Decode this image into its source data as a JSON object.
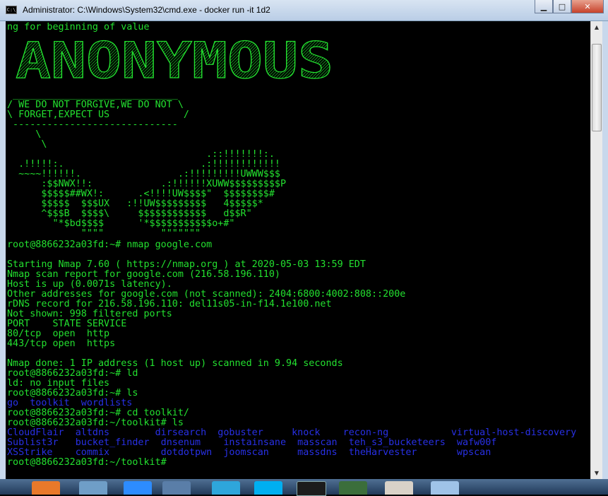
{
  "window": {
    "title": "Administrator: C:\\Windows\\System32\\cmd.exe - docker  run -it 1d2",
    "minimize_icon": "minimize-icon",
    "maximize_icon": "maximize-icon",
    "close_icon": "close-icon"
  },
  "terminal": {
    "top_line": "ng for beginning of value",
    "banner_logo": "ANONYMOUS",
    "banner_box": [
      " _____________________________",
      "/ WE DO NOT FORGIVE,WE DO NOT \\",
      "\\ FORGET,EXPECT US             /",
      " -----------------------------",
      "     \\",
      "      \\"
    ],
    "art": [
      "                                   .::!!!!!!!:.",
      "  .!!!!!:.                        .:!!!!!!!!!!!!",
      "  ~~~~!!!!!!.                 .:!!!!!!!!!UWWW$$$",
      "      :$$NWX!!:            .:!!!!!!XUWW$$$$$$$$$P",
      "      $$$$$##WX!:      .<!!!!UW$$$$\"  $$$$$$$$#",
      "      $$$$$  $$$UX   :!!UW$$$$$$$$$   4$$$$$*",
      "      ^$$$B  $$$$\\     $$$$$$$$$$$$   d$$R\"",
      "        \"*$bd$$$$      '*$$$$$$$$$$$o+#\"",
      "             \"\"\"\"          \"\"\"\"\"\"\""
    ],
    "lines": [
      "root@8866232a03fd:~# nmap google.com",
      "",
      "Starting Nmap 7.60 ( https://nmap.org ) at 2020-05-03 13:59 EDT",
      "Nmap scan report for google.com (216.58.196.110)",
      "Host is up (0.0071s latency).",
      "Other addresses for google.com (not scanned): 2404:6800:4002:808::200e",
      "rDNS record for 216.58.196.110: del11s05-in-f14.1e100.net",
      "Not shown: 998 filtered ports",
      "PORT    STATE SERVICE",
      "80/tcp  open  http",
      "443/tcp open  https",
      "",
      "Nmap done: 1 IP address (1 host up) scanned in 9.94 seconds",
      "root@8866232a03fd:~# ld",
      "ld: no input files",
      "root@8866232a03fd:~# ls"
    ],
    "ls_output": "go  toolkit  wordlists",
    "cd_line": "root@8866232a03fd:~# cd toolkit/",
    "ls2_line": "root@8866232a03fd:~/toolkit# ls",
    "toolkit_rows": [
      "CloudFlair  altdns        dirsearch  gobuster     knock    recon-ng           virtual-host-discovery",
      "Sublist3r   bucket_finder  dnsenum    instainsane  masscan  teh_s3_bucketeers  wafw00f",
      "XSStrike    commix         dotdotpwn  joomscan     massdns  theHarvester       wpscan"
    ],
    "final_prompt": "root@8866232a03fd:~/toolkit#"
  },
  "colors": {
    "text_green": "#23e02f",
    "dir_blue": "#2830e6",
    "background": "#000000"
  },
  "taskbar": {
    "items": [
      "firefox-icon",
      "network-icon",
      "zoom-icon",
      "wifi-icon",
      "telegram-icon",
      "skype-icon",
      "cmd-icon",
      "task-manager-icon",
      "opera-icon",
      "explorer-icon"
    ]
  }
}
